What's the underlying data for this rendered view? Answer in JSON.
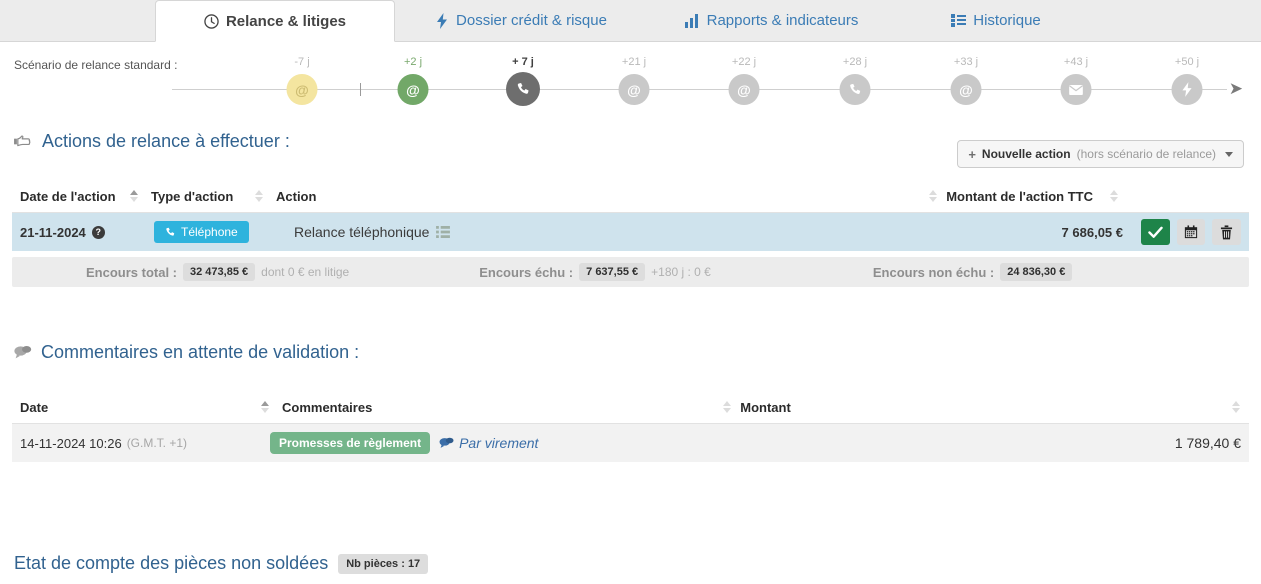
{
  "tabs": [
    {
      "label": "Relance & litiges",
      "icon": "clock-icon",
      "active": true
    },
    {
      "label": "Dossier crédit & risque",
      "icon": "bolt-icon",
      "active": false
    },
    {
      "label": "Rapports & indicateurs",
      "icon": "bar-chart-icon",
      "active": false
    },
    {
      "label": "Historique",
      "icon": "list-icon",
      "active": false
    }
  ],
  "scenario": {
    "label": "Scénario de relance standard :",
    "nodes": [
      {
        "day": "-7 j",
        "icon": "at-icon",
        "color": "#f4e5a0",
        "state": "past"
      },
      {
        "day": "+2 j",
        "icon": "at-icon",
        "color": "#72a868",
        "state": "done"
      },
      {
        "day": "+ 7 j",
        "icon": "phone-icon",
        "color": "#6e6e6e",
        "state": "current"
      },
      {
        "day": "+21 j",
        "icon": "at-icon",
        "color": "#c9c9c9",
        "state": "future"
      },
      {
        "day": "+22 j",
        "icon": "at-icon",
        "color": "#c9c9c9",
        "state": "future"
      },
      {
        "day": "+28 j",
        "icon": "phone-icon",
        "color": "#c9c9c9",
        "state": "future"
      },
      {
        "day": "+33 j",
        "icon": "at-icon",
        "color": "#c9c9c9",
        "state": "future"
      },
      {
        "day": "+43 j",
        "icon": "mail-icon",
        "color": "#c9c9c9",
        "state": "future"
      },
      {
        "day": "+50 j",
        "icon": "bolt-icon",
        "color": "#c9c9c9",
        "state": "future"
      }
    ]
  },
  "actions_section": {
    "title": "Actions de relance à effectuer :",
    "icon": "pointing-hand-icon",
    "new_action": {
      "plus": "+",
      "label": "Nouvelle action",
      "sublabel": "(hors scénario de relance)"
    },
    "columns": [
      {
        "key": "date",
        "label": "Date de l'action",
        "sortable": true
      },
      {
        "key": "type",
        "label": "Type d'action",
        "sortable": true
      },
      {
        "key": "act",
        "label": "Action",
        "sortable": false
      },
      {
        "key": "amt",
        "label": "Montant de l'action TTC",
        "sortable": true
      }
    ],
    "rows": [
      {
        "date": "21-11-2024",
        "date_badge": "?",
        "type_badge": "Téléphone",
        "type_icon": "phone-icon",
        "action": "Relance téléphonique",
        "action_icon": "list-icon",
        "amount": "7 686,05 €",
        "buttons": [
          {
            "name": "validate-action-button",
            "icon": "check-icon"
          },
          {
            "name": "reschedule-action-button",
            "icon": "calendar-icon"
          },
          {
            "name": "delete-action-button",
            "icon": "trash-icon"
          }
        ]
      }
    ]
  },
  "encours": {
    "total_label": "Encours total :",
    "total_value": "32 473,85 €",
    "total_note": "dont 0 € en litige",
    "echu_label": "Encours échu :",
    "echu_value": "7 637,55 €",
    "echu_note": "+180 j : 0 €",
    "non_echu_label": "Encours non échu :",
    "non_echu_value": "24 836,30 €"
  },
  "comments_section": {
    "title": "Commentaires en attente de validation :",
    "icon": "comment-icon",
    "columns": [
      {
        "key": "date",
        "label": "Date",
        "sortable": true
      },
      {
        "key": "com",
        "label": "Commentaires",
        "sortable": false
      },
      {
        "key": "amt",
        "label": "Montant",
        "sortable": true
      }
    ],
    "rows": [
      {
        "date": "14-11-2024 10:26",
        "gmt": "(G.M.T. +1)",
        "badge": "Promesses de règlement",
        "link": "Par virement",
        "link_icon": "comment-icon",
        "amount": "1 789,40 €"
      }
    ]
  },
  "footer": {
    "title": "Etat de compte des pièces non soldées",
    "pill": "Nb pièces : 17"
  },
  "colors": {
    "accent_blue": "#31628f",
    "tab_link": "#3b7cb5",
    "badge_phone": "#2eb3dd",
    "validate_green": "#1e8449",
    "promise_green": "#74b58a",
    "row_selected": "#cfe3ed",
    "row_alt": "#f2f2f2",
    "chrome_grey": "#ececec"
  }
}
